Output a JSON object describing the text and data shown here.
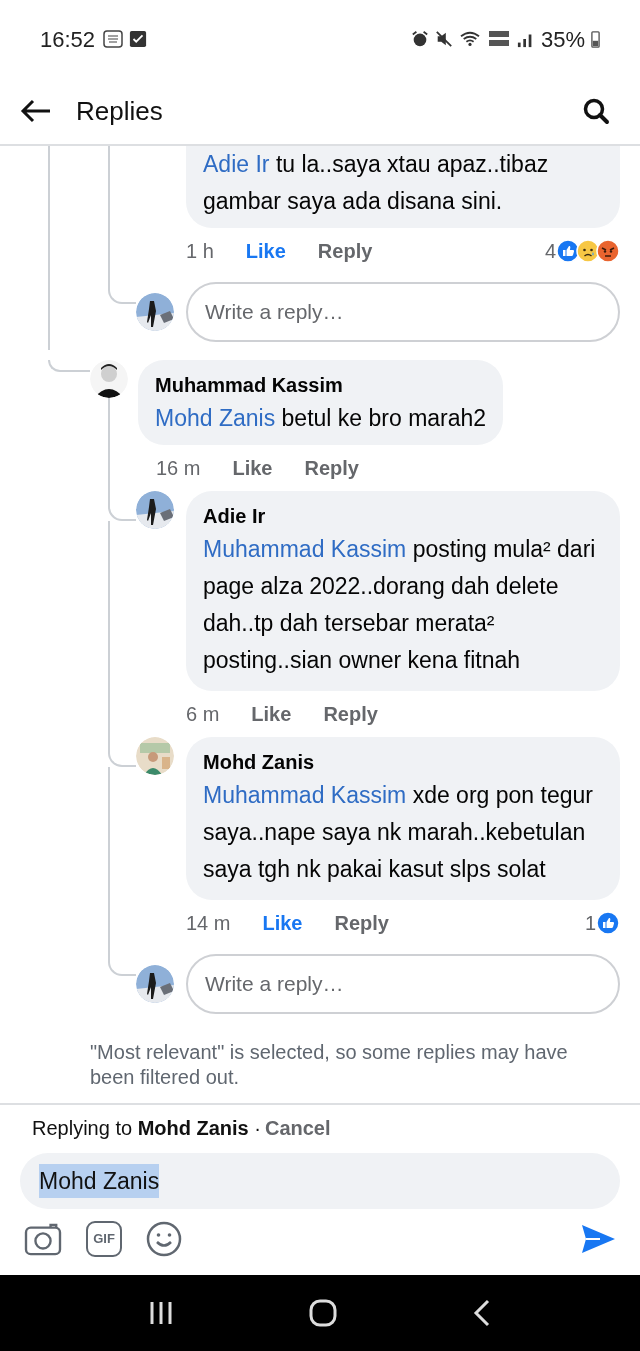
{
  "status_bar": {
    "time": "16:52",
    "battery": "35%"
  },
  "header": {
    "title": "Replies"
  },
  "earlier_reply": {
    "mention": "Adie Ir",
    "text": "tu la..saya xtau apaz..tibaz gambar saya ada disana sini.",
    "time": "1 h",
    "like": "Like",
    "liked": true,
    "reply": "Reply",
    "reaction_count": "4",
    "reactions": [
      {
        "kind": "like"
      },
      {
        "kind": "sad"
      },
      {
        "kind": "angry"
      }
    ]
  },
  "earlier_reply_box": {
    "placeholder": "Write a reply…"
  },
  "comment": {
    "author": "Muhammad Kassim",
    "mention": "Mohd Zanis",
    "text": "betul ke bro marah2",
    "time": "16 m",
    "like": "Like",
    "liked": false,
    "reply": "Reply",
    "children": [
      {
        "author": "Adie Ir",
        "mention": "Muhammad Kassim",
        "text": "posting mula² dari page alza 2022..dorang dah delete dah..tp dah tersebar merata² posting..sian owner kena fitnah",
        "time": "6 m",
        "like": "Like",
        "liked": false,
        "reply": "Reply"
      },
      {
        "author": "Mohd Zanis",
        "mention": "Muhammad Kassim",
        "text": "xde org pon tegur saya..nape saya nk marah..kebetulan saya tgh nk pakai kasut slps solat",
        "time": "14 m",
        "like": "Like",
        "liked": true,
        "reply": "Reply",
        "reaction_count": "1",
        "reactions": [
          {
            "kind": "like"
          }
        ]
      }
    ],
    "reply_box": {
      "placeholder": "Write a reply…"
    }
  },
  "filter_note": "\"Most relevant\" is selected, so some replies may have been filtered out.",
  "composer": {
    "replying": "Replying to **Mohd Zanis** ·",
    "cancel": "Cancel",
    "gif": "GIF",
    "value": "Mohd Zanis",
    "value_selected": true
  }
}
